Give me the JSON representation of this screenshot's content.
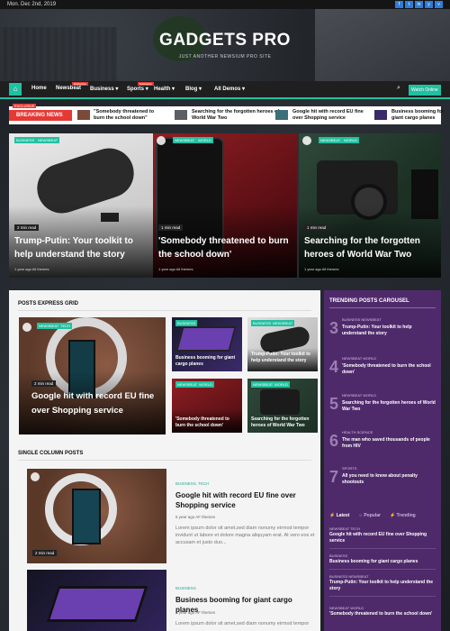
{
  "topbar": {
    "date": "Mon. Dec 2nd, 2019",
    "social": [
      "f",
      "t",
      "in",
      "y",
      "v"
    ]
  },
  "header": {
    "title": "GADGETS PRO",
    "tagline": "JUST ANOTHER NEWSIUM PRO SITE"
  },
  "nav": {
    "home_icon": "home-icon",
    "items": [
      "Home",
      "Newsbeat",
      "Business",
      "Sports",
      "Health",
      "Blog",
      "All Demos"
    ],
    "badge_newsbeat": "Exclusive",
    "badge_sports": "Exclusive",
    "watch_label": "Watch Online",
    "accent": "#22c0a0"
  },
  "ticker": {
    "label": "BREAKING NEWS",
    "exclusive": "EXCLUSIVE",
    "items": [
      "\"Somebody threatened to burn the school down\"",
      "Searching for the forgotten heroes of World War Two",
      "Google hit with record EU fine over Shopping service",
      "Business booming for giant cargo planes"
    ]
  },
  "featured": [
    {
      "tags": [
        "BUSINESS",
        "NEWSBEAT"
      ],
      "read": "2 min read",
      "title": "Trump-Putin: Your toolkit to help understand the story",
      "meta": "1 year ago  All themes"
    },
    {
      "tags": [
        "NEWSBEAT",
        "WORLD"
      ],
      "read": "1 min read",
      "title": "'Somebody threatened to burn the school down'",
      "meta": "1 year ago  All themes"
    },
    {
      "tags": [
        "NEWSBEAT",
        "WORLD"
      ],
      "read": "1 min read",
      "title": "Searching for the forgotten heroes of World War Two",
      "meta": "1 year ago  All themes"
    }
  ],
  "express": {
    "heading": "POSTS EXPRESS GRID",
    "main": {
      "tags": [
        "NEWSBEAT",
        "TECH"
      ],
      "read": "2 min read",
      "title": "Google hit with record EU fine over Shopping service"
    },
    "cards": [
      {
        "tags": [
          "BUSINESS"
        ],
        "title": "Business booming for giant cargo planes"
      },
      {
        "tags": [
          "BUSINESS",
          "NEWSBEAT"
        ],
        "title": "Trump-Putin: Your toolkit to help understand the story"
      },
      {
        "tags": [
          "NEWSBEAT",
          "WORLD"
        ],
        "title": "'Somebody threatened to burn the school down'"
      },
      {
        "tags": [
          "NEWSBEAT",
          "WORLD"
        ],
        "title": "Searching for the forgotten heroes of World War Two"
      }
    ]
  },
  "single": {
    "heading": "SINGLE COLUMN POSTS",
    "posts": [
      {
        "tags": "BUSINESS, TECH",
        "read": "2 min read",
        "title": "Google hit with record EU fine over Shopping service",
        "meta": "5 year ago   AF themes",
        "excerpt": "Lorem ipsum dolor sit amet,sed diam nonumy eirmod tempor invidunt ut labore et dolore magna aliquyam erat. At vero eos et accusam et justo duo..."
      },
      {
        "tags": "BUSINESS",
        "title": "Business booming for giant cargo planes",
        "meta": "5 year ago   AF themes",
        "excerpt": "Lorem ipsum dolor sit amet,sed diam nonumy eirmod tempor"
      }
    ]
  },
  "trending": {
    "heading": "TRENDING POSTS CAROUSEL",
    "items": [
      {
        "num": "3",
        "tags": "BUSINESS  NEWSBEAT",
        "title": "Trump-Putin: Your toolkit to help understand the story"
      },
      {
        "num": "4",
        "tags": "NEWSBEAT  WORLD",
        "title": "'Somebody threatened to burn the school down'"
      },
      {
        "num": "5",
        "tags": "NEWSBEAT  WORLD",
        "title": "Searching for the forgotten heroes of World War Two"
      },
      {
        "num": "6",
        "tags": "HEALTH  SCIENCE",
        "title": "The man who saved thousands of people from HIV"
      },
      {
        "num": "7",
        "tags": "SPORTS",
        "title": "All you need to know about penalty shootouts"
      }
    ],
    "tabs": [
      "Latest",
      "Popular",
      "Trending"
    ],
    "latest": [
      {
        "tags": "NEWSBEAT  TECH",
        "title": "Google hit with record EU fine over Shopping service"
      },
      {
        "tags": "BUSINESS",
        "title": "Business booming for giant cargo planes"
      },
      {
        "tags": "BUSINESS  NEWSBEAT",
        "title": "Trump-Putin: Your toolkit to help understand the story"
      },
      {
        "tags": "NEWSBEAT  WORLD",
        "title": "'Somebody threatened to burn the school down'"
      }
    ]
  }
}
